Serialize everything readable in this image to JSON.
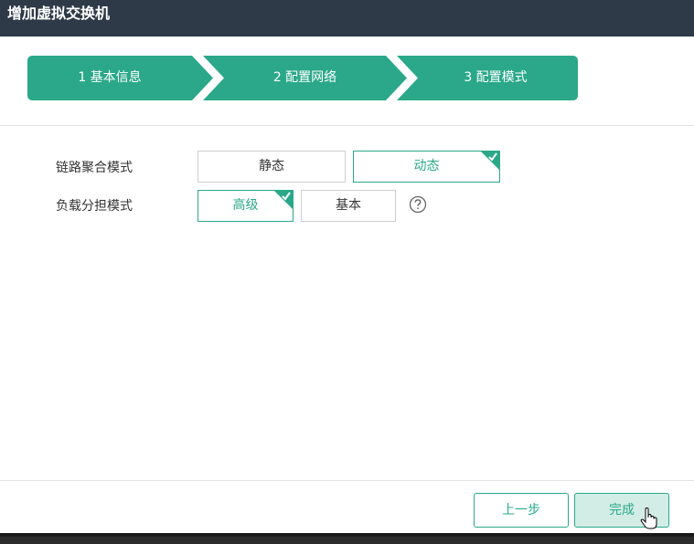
{
  "dialog": {
    "title": "增加虚拟交换机"
  },
  "steps": [
    {
      "label": "1 基本信息"
    },
    {
      "label": "2 配置网络"
    },
    {
      "label": "3 配置模式"
    }
  ],
  "form": {
    "link_aggregation": {
      "label": "链路聚合模式",
      "options": [
        "静态",
        "动态"
      ],
      "selected": "动态"
    },
    "load_balancing": {
      "label": "负载分担模式",
      "options": [
        "高级",
        "基本"
      ],
      "selected": "高级"
    },
    "help_icon": "question-circle-icon"
  },
  "footer": {
    "prev_label": "上一步",
    "finish_label": "完成"
  },
  "colors": {
    "accent": "#2aa889",
    "titlebar": "#2e3a48",
    "step_bg": "#2aa889"
  }
}
